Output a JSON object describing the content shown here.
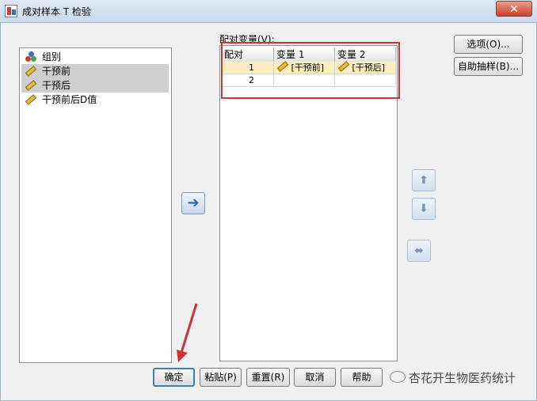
{
  "window": {
    "title": "成对样本 T 检验",
    "close_symbol": "✕"
  },
  "source_variables": [
    {
      "label": "组别",
      "type": "nominal",
      "selected": false
    },
    {
      "label": "干预前",
      "type": "scale",
      "selected": true
    },
    {
      "label": "干预后",
      "type": "scale",
      "selected": true
    },
    {
      "label": "干预前后D值",
      "type": "scale",
      "selected": false
    }
  ],
  "move_button": {
    "symbol": "➔"
  },
  "paired_variables": {
    "label": "配对变量(V):",
    "columns": [
      "配对",
      "变量 1",
      "变量 2"
    ],
    "rows": [
      {
        "pair": "1",
        "var1": "[干预前]",
        "var2": "[干预后]"
      },
      {
        "pair": "2",
        "var1": "",
        "var2": ""
      }
    ]
  },
  "side_buttons": {
    "options": "选项(O)...",
    "bootstrap": "自助抽样(B)..."
  },
  "reorder": {
    "up": "⬆",
    "down": "⬇",
    "swap": "⬌"
  },
  "bottom_buttons": {
    "ok": "确定",
    "paste": "粘贴(P)",
    "reset": "重置(R)",
    "cancel": "取消",
    "help": "帮助"
  },
  "watermark": "杏花开生物医药统计",
  "colors": {
    "highlight_box": "#d0323a",
    "selected_row": "#ffeebd",
    "annotation_arrow": "#d0323a"
  }
}
